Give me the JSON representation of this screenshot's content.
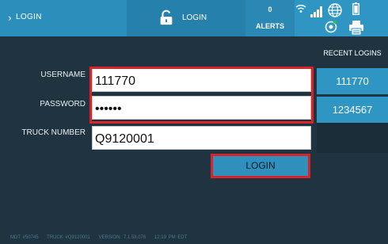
{
  "nav": {
    "back_label": "LOGIN",
    "title": "LOGIN",
    "alerts_count": "0",
    "alerts_label": "ALERTS"
  },
  "form": {
    "username_label": "USERNAME",
    "username_value": "111770",
    "password_label": "PASSWORD",
    "password_value": "••••••",
    "truck_label": "TRUCK NUMBER",
    "truck_value": "Q9120001",
    "login_button": "LOGIN"
  },
  "recent": {
    "heading": "RECENT LOGINS",
    "items": [
      "111770",
      "1234567"
    ]
  },
  "footer": {
    "mdt": "MDT #50745",
    "truck": "TRUCK #Q9120001",
    "version": "VERSION: 7.1.58.076",
    "time": "12:19 PM EDT"
  },
  "colors": {
    "accent": "#2f96c4",
    "background": "#1f3340",
    "highlight": "#d8232a"
  },
  "icons": [
    "chevron-right-icon",
    "lock-icon",
    "wifi-icon",
    "signal-icon",
    "globe-icon",
    "battery-icon",
    "gps-icon",
    "printer-icon"
  ]
}
